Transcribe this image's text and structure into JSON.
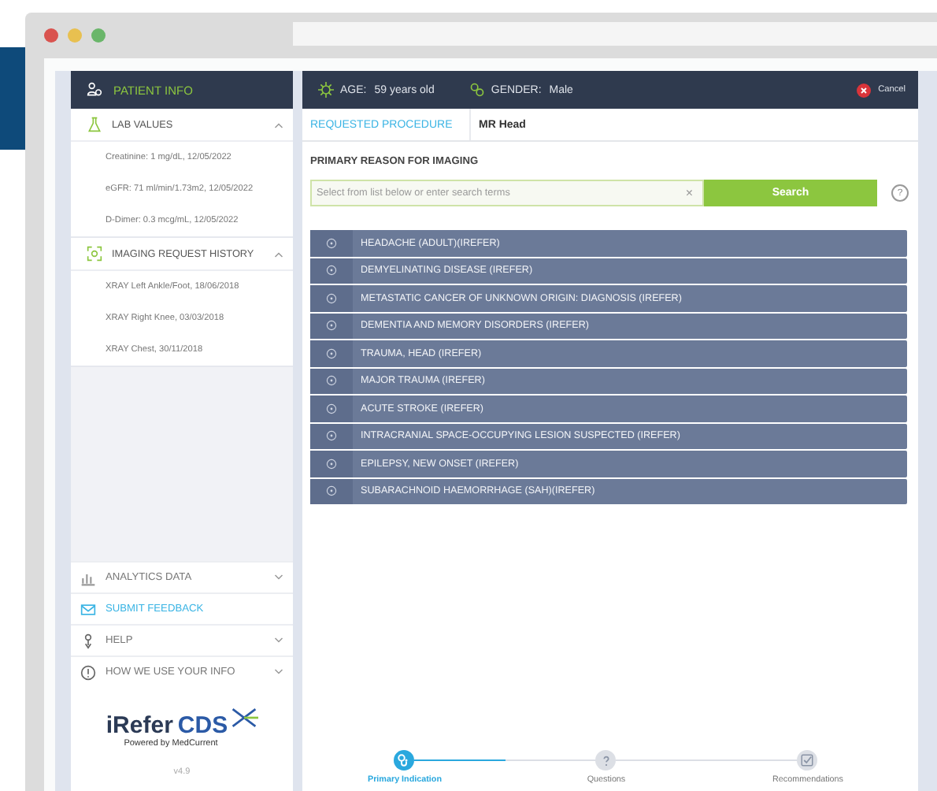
{
  "patient_info": {
    "title": "PATIENT INFO"
  },
  "sidebar_sections": [
    {
      "title": "LAB VALUES",
      "expanded": true,
      "items": [
        "Creatinine: 1 mg/dL, 12/05/2022",
        "eGFR: 71 ml/min/1.73m2, 12/05/2022",
        "D-Dimer: 0.3 mcg/mL, 12/05/2022"
      ]
    },
    {
      "title": "IMAGING REQUEST HISTORY",
      "expanded": true,
      "items": [
        "XRAY Left Ankle/Foot, 18/06/2018",
        "XRAY Right Knee, 03/03/2018",
        "XRAY Chest, 30/11/2018"
      ]
    }
  ],
  "sidebar_menu": [
    {
      "label": "ANALYTICS DATA",
      "kind": "menu",
      "expanded": false
    },
    {
      "label": "SUBMIT FEEDBACK",
      "kind": "link"
    },
    {
      "label": "HELP",
      "kind": "menu",
      "expanded": false
    },
    {
      "label": "HOW WE USE YOUR INFO",
      "kind": "menu",
      "expanded": false
    }
  ],
  "logo": {
    "name": "iRefer",
    "name_accent": "CDS",
    "tagline": "Powered by MedCurrent",
    "version": "v4.9"
  },
  "header": {
    "age_label": "AGE:",
    "age": "59 years old",
    "gender_label": "GENDER:",
    "gender": "Male",
    "cancel": "Cancel"
  },
  "procedure": {
    "label": "REQUESTED PROCEDURE",
    "value": "MR Head"
  },
  "reason": {
    "title": "PRIMARY REASON FOR IMAGING",
    "placeholder": "Select from list below or enter search terms",
    "clear": "×",
    "search_button": "Search",
    "help": "?"
  },
  "indications": [
    "HEADACHE (ADULT)(IREFER)",
    "DEMYELINATING DISEASE (IREFER)",
    "METASTATIC CANCER OF UNKNOWN ORIGIN: DIAGNOSIS (IREFER)",
    "DEMENTIA AND MEMORY DISORDERS (IREFER)",
    "TRAUMA, HEAD (IREFER)",
    "MAJOR TRAUMA (IREFER)",
    "ACUTE STROKE (IREFER)",
    "INTRACRANIAL SPACE-OCCUPYING LESION SUSPECTED (IREFER)",
    "EPILEPSY, NEW ONSET (IREFER)",
    "SUBARACHNOID HAEMORRHAGE (SAH)(IREFER)"
  ],
  "steps": [
    {
      "label": "Primary Indication",
      "selected": true
    },
    {
      "label": "Questions",
      "selected": false
    },
    {
      "label": "Recommendations",
      "selected": false
    }
  ],
  "connectors": [
    {
      "level": 0.5
    },
    {
      "level": 0
    }
  ]
}
